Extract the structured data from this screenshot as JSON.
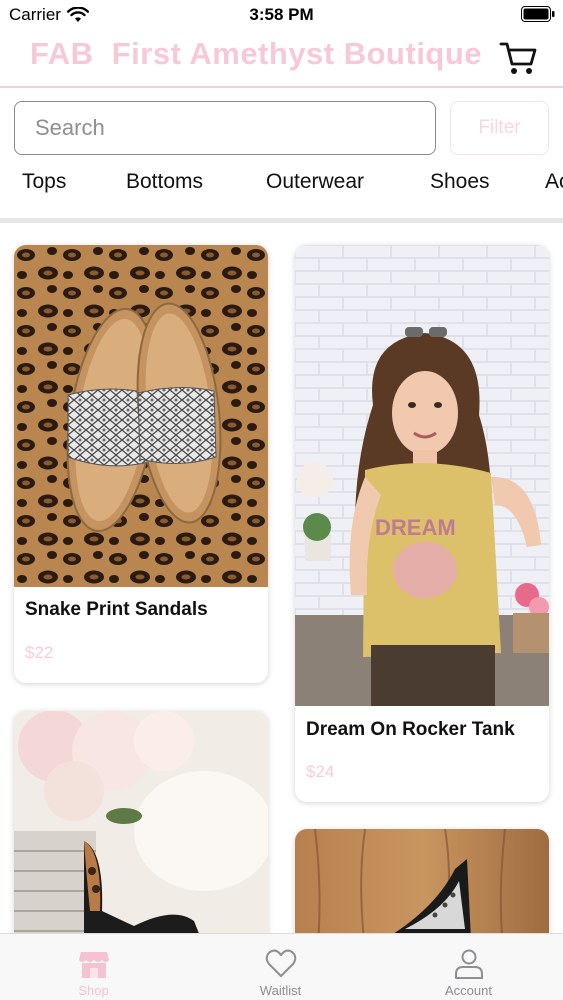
{
  "status_bar": {
    "carrier": "Carrier",
    "time": "3:58 PM"
  },
  "header": {
    "title": "FAB  First Amethyst Boutique",
    "cart_icon": "cart-icon",
    "title_color": "#f7c9d6"
  },
  "search": {
    "placeholder": "Search",
    "filter_label": "Filter"
  },
  "categories": [
    "Tops",
    "Bottoms",
    "Outerwear",
    "Shoes",
    "Ac"
  ],
  "products": [
    {
      "name": "Snake Print Sandals",
      "price": "$22"
    },
    {
      "name": "Dream On Rocker Tank",
      "price": "$24"
    },
    {
      "name": "",
      "price": ""
    },
    {
      "name": "",
      "price": ""
    }
  ],
  "tab_bar": {
    "items": [
      {
        "label": "Shop",
        "icon": "store-icon",
        "active": true
      },
      {
        "label": "Waitlist",
        "icon": "heart-icon",
        "active": false
      },
      {
        "label": "Account",
        "icon": "person-icon",
        "active": false
      }
    ],
    "active_color": "#f4c2d0",
    "inactive_color": "#8e8e93"
  },
  "colors": {
    "accent_pink": "#f7c9d6",
    "divider": "#e6e6e6"
  }
}
